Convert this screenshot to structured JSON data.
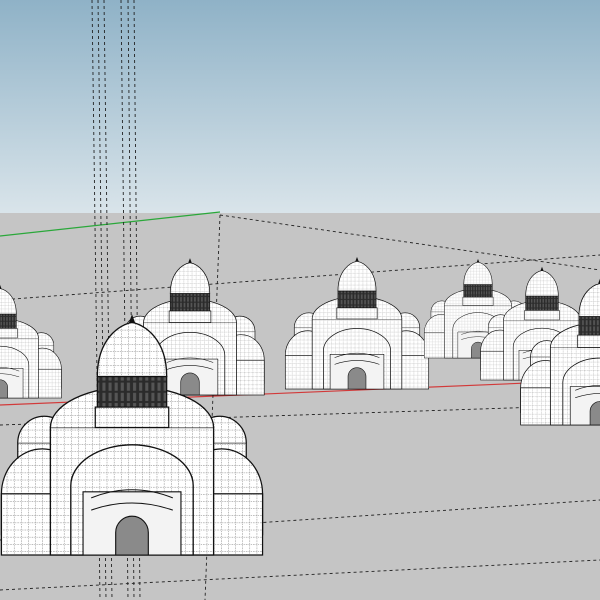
{
  "app": {
    "name": "",
    "title": ""
  },
  "viewport": {
    "camera": "perspective",
    "style": "hidden-line",
    "sky_top_color": "#8fb2c7",
    "sky_bottom_color": "#d9e4ea",
    "ground_color": "#c5c5c5"
  },
  "axes": {
    "red_axis_color": "#d23a3a",
    "green_axis_color": "#2aa83a",
    "blue_axis_color": "#2f6fd8"
  },
  "model": {
    "type": "domed-churches",
    "selection": "none",
    "items": [
      {
        "name": "church-left-edge"
      },
      {
        "name": "church-back-left"
      },
      {
        "name": "church-foreground"
      },
      {
        "name": "church-center"
      },
      {
        "name": "church-back-right"
      },
      {
        "name": "church-right"
      },
      {
        "name": "church-far-right"
      }
    ]
  },
  "guides": {
    "style": "dashed",
    "count": 10
  }
}
